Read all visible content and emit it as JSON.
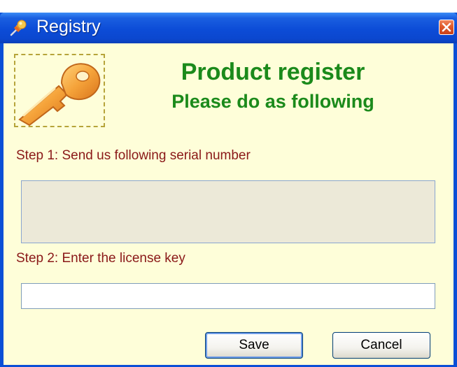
{
  "window": {
    "title": "Registry",
    "close_icon": "close-icon"
  },
  "header": {
    "title": "Product register",
    "subtitle": "Please do as following",
    "logo_icon": "key-icon"
  },
  "steps": {
    "step1_label": "Step 1: Send us following serial number",
    "serial_value": "",
    "step2_label": "Step 2: Enter the license key",
    "license_value": "",
    "license_placeholder": ""
  },
  "buttons": {
    "save_label": "Save",
    "cancel_label": "Cancel"
  },
  "colors": {
    "title_bar": "#0c4cd7",
    "client_background": "#fefed9",
    "heading": "#1b8a1b",
    "step_label": "#8a1818",
    "serial_box_background": "#ece9d8"
  }
}
